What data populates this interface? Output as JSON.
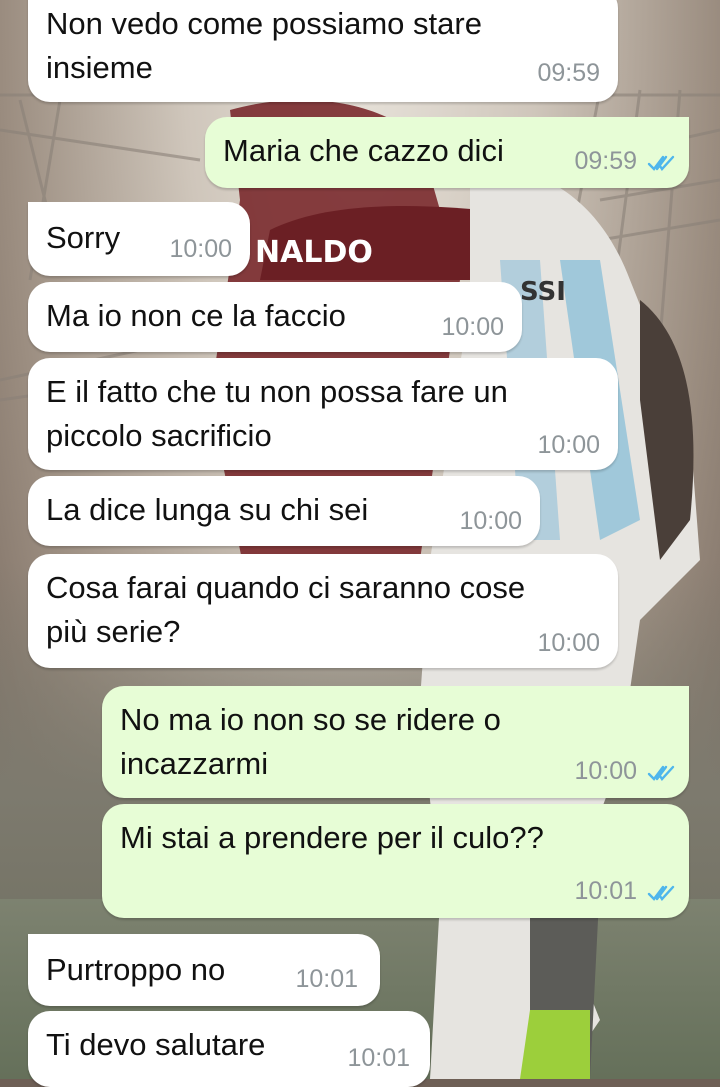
{
  "colors": {
    "incoming_bubble": "#ffffff",
    "outgoing_bubble": "#e7fdd6",
    "timestamp": "#8e9599",
    "read_ticks": "#4fb6ec"
  },
  "wallpaper": {
    "jersey_left": "NALDO",
    "jersey_right": "SSI"
  },
  "messages": [
    {
      "direction": "incoming",
      "text_lines": [
        "Non vedo come possiamo stare",
        "insieme"
      ],
      "time": "09:59"
    },
    {
      "direction": "outgoing",
      "text_lines": [
        "Maria che cazzo dici"
      ],
      "time": "09:59",
      "status": "read-ticks-icon"
    },
    {
      "direction": "incoming",
      "text_lines": [
        "Sorry"
      ],
      "time": "10:00"
    },
    {
      "direction": "incoming",
      "text_lines": [
        "Ma io non ce la faccio"
      ],
      "time": "10:00"
    },
    {
      "direction": "incoming",
      "text_lines": [
        "E il fatto che tu non possa fare un",
        "piccolo sacrificio"
      ],
      "time": "10:00"
    },
    {
      "direction": "incoming",
      "text_lines": [
        "La dice lunga su chi sei"
      ],
      "time": "10:00"
    },
    {
      "direction": "incoming",
      "text_lines": [
        "Cosa farai quando ci saranno cose",
        "più serie?"
      ],
      "time": "10:00"
    },
    {
      "direction": "outgoing",
      "text_lines": [
        "No ma io non so se ridere o",
        "incazzarmi"
      ],
      "time": "10:00",
      "status": "read-ticks-icon"
    },
    {
      "direction": "outgoing",
      "text_lines": [
        "Mi stai a prendere per il culo??"
      ],
      "time": "10:01",
      "status": "read-ticks-icon"
    },
    {
      "direction": "incoming",
      "text_lines": [
        "Purtroppo no"
      ],
      "time": "10:01"
    },
    {
      "direction": "incoming",
      "text_lines": [
        "Ti devo salutare"
      ],
      "time": "10:01"
    }
  ]
}
